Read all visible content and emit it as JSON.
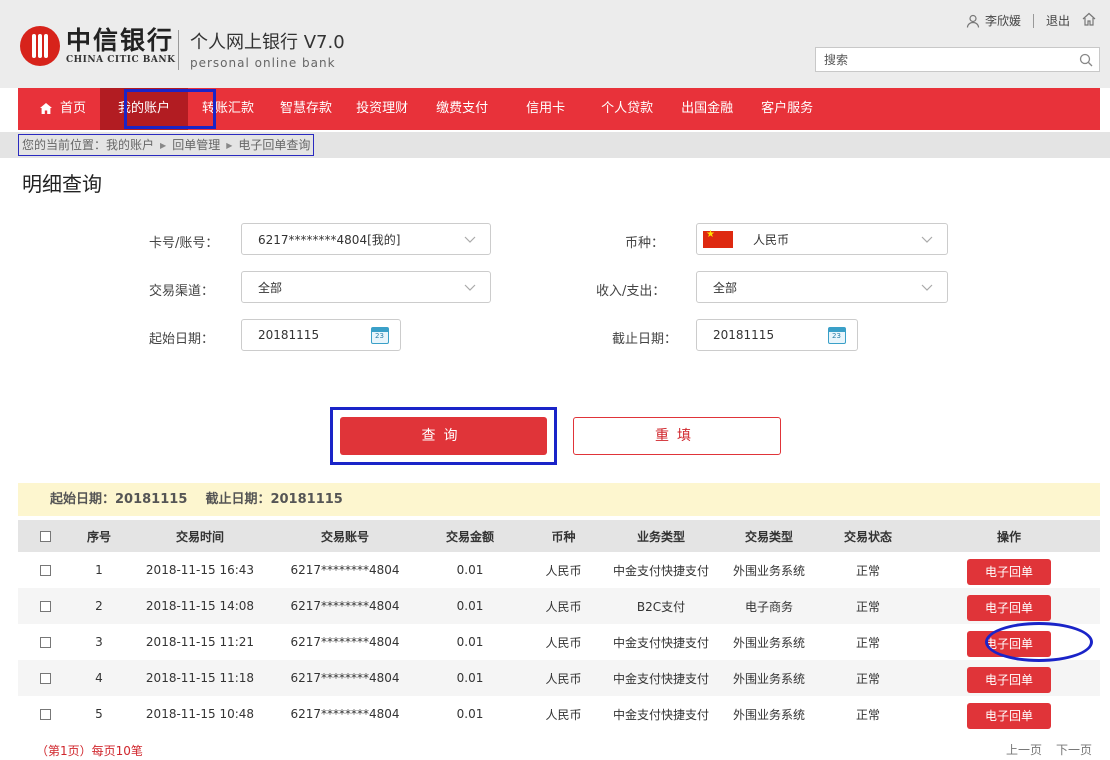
{
  "header": {
    "bank_cn": "中信银行",
    "bank_en": "CHINA CITIC BANK",
    "product_cn": "个人网上银行 V7.0",
    "product_en": "personal online bank",
    "user_name": "李欣媛",
    "logout": "退出",
    "search_placeholder": "搜索"
  },
  "nav": [
    "首页",
    "我的账户",
    "转账汇款",
    "智慧存款",
    "投资理财",
    "缴费支付",
    "信用卡",
    "个人贷款",
    "出国金融",
    "客户服务"
  ],
  "breadcrumb": {
    "prefix": "您的当前位置：",
    "items": [
      "我的账户",
      "回单管理",
      "电子回单查询"
    ]
  },
  "page_title": "明细查询",
  "form": {
    "card_label": "卡号/账号：",
    "card_value": "6217********4804[我的]",
    "currency_label": "币种：",
    "currency_value": "人民币",
    "channel_label": "交易渠道：",
    "channel_value": "全部",
    "io_label": "收入/支出：",
    "io_value": "全部",
    "start_label": "起始日期：",
    "start_value": "20181115",
    "end_label": "截止日期：",
    "end_value": "20181115",
    "query_button": "查询",
    "reset_button": "重填"
  },
  "range_text": "起始日期：20181115    截止日期：20181115",
  "table": {
    "headers": [
      "序号",
      "交易时间",
      "交易账号",
      "交易金额",
      "币种",
      "业务类型",
      "交易类型",
      "交易状态",
      "操作"
    ],
    "rows": [
      {
        "no": "1",
        "time": "2018-11-15  16:43",
        "account": "6217********4804",
        "amount": "0.01",
        "currency": "人民币",
        "biz": "中金支付快捷支付",
        "type": "外围业务系统",
        "status": "正常",
        "op": "电子回单"
      },
      {
        "no": "2",
        "time": "2018-11-15  14:08",
        "account": "6217********4804",
        "amount": "0.01",
        "currency": "人民币",
        "biz": "B2C支付",
        "type": "电子商务",
        "status": "正常",
        "op": "电子回单"
      },
      {
        "no": "3",
        "time": "2018-11-15  11:21",
        "account": "6217********4804",
        "amount": "0.01",
        "currency": "人民币",
        "biz": "中金支付快捷支付",
        "type": "外围业务系统",
        "status": "正常",
        "op": "电子回单"
      },
      {
        "no": "4",
        "time": "2018-11-15  11:18",
        "account": "6217********4804",
        "amount": "0.01",
        "currency": "人民币",
        "biz": "中金支付快捷支付",
        "type": "外围业务系统",
        "status": "正常",
        "op": "电子回单"
      },
      {
        "no": "5",
        "time": "2018-11-15  10:48",
        "account": "6217********4804",
        "amount": "0.01",
        "currency": "人民币",
        "biz": "中金支付快捷支付",
        "type": "外围业务系统",
        "status": "正常",
        "op": "电子回单"
      }
    ]
  },
  "pagination": {
    "note": "（第1页）每页10笔",
    "prev": "上一页",
    "next": "下一页"
  },
  "colors": {
    "brand_red": "#e8323a",
    "annotation_blue": "#1a24c8"
  }
}
